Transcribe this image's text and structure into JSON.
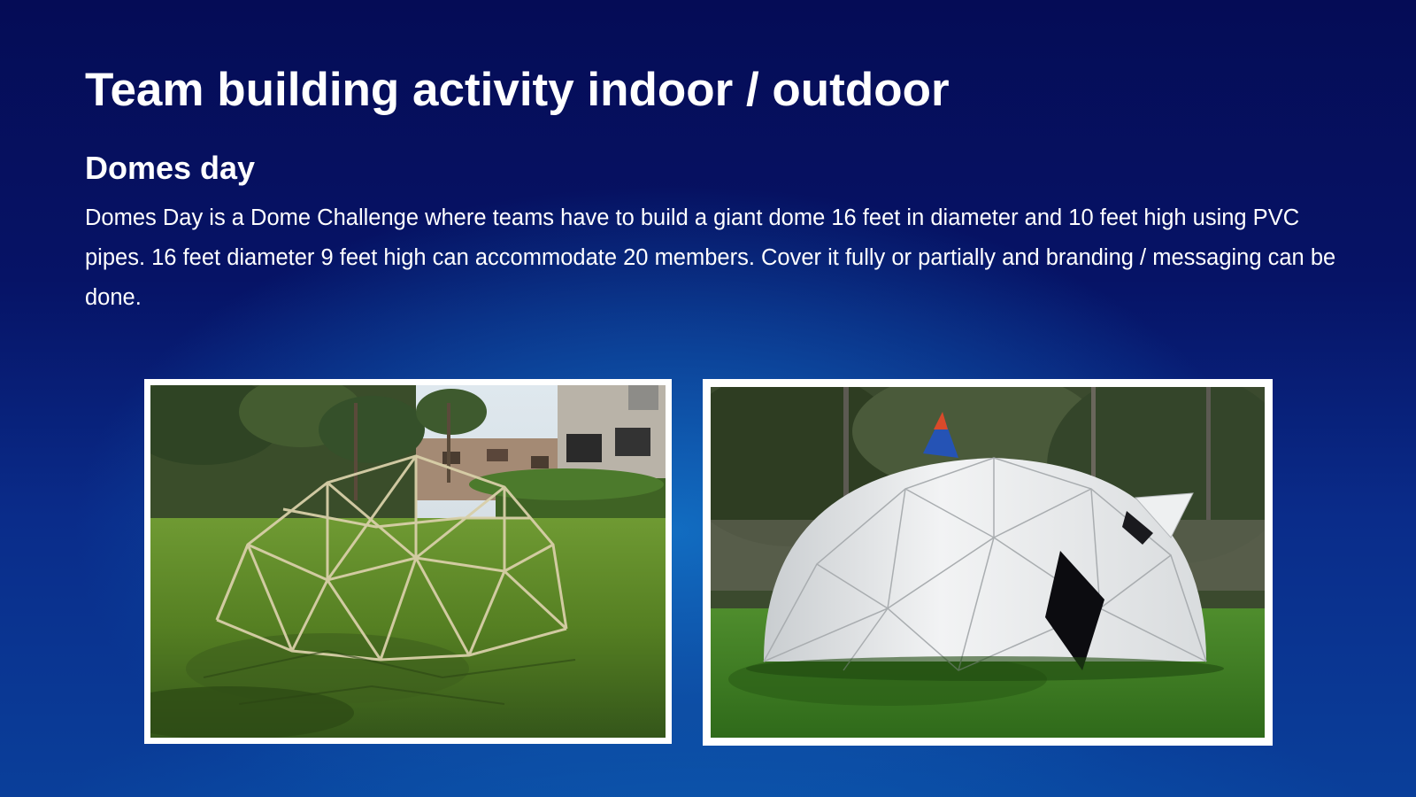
{
  "slide": {
    "title": "Team building activity indoor / outdoor",
    "subtitle": "Domes day",
    "body": "Domes Day is a Dome Challenge  where teams have to build a giant dome 16 feet in diameter and 10 feet high using PVC pipes. 16 feet diameter 9 feet high can accommodate 20 members. Cover it fully or partially and branding / messaging can be done."
  },
  "colors": {
    "background_dark": "#050c56",
    "background_light": "#0a5cb2",
    "text": "#ffffff",
    "photo_border": "#ffffff"
  },
  "images": [
    {
      "name": "pipe-frame-dome-photo"
    },
    {
      "name": "covered-white-dome-photo"
    }
  ]
}
